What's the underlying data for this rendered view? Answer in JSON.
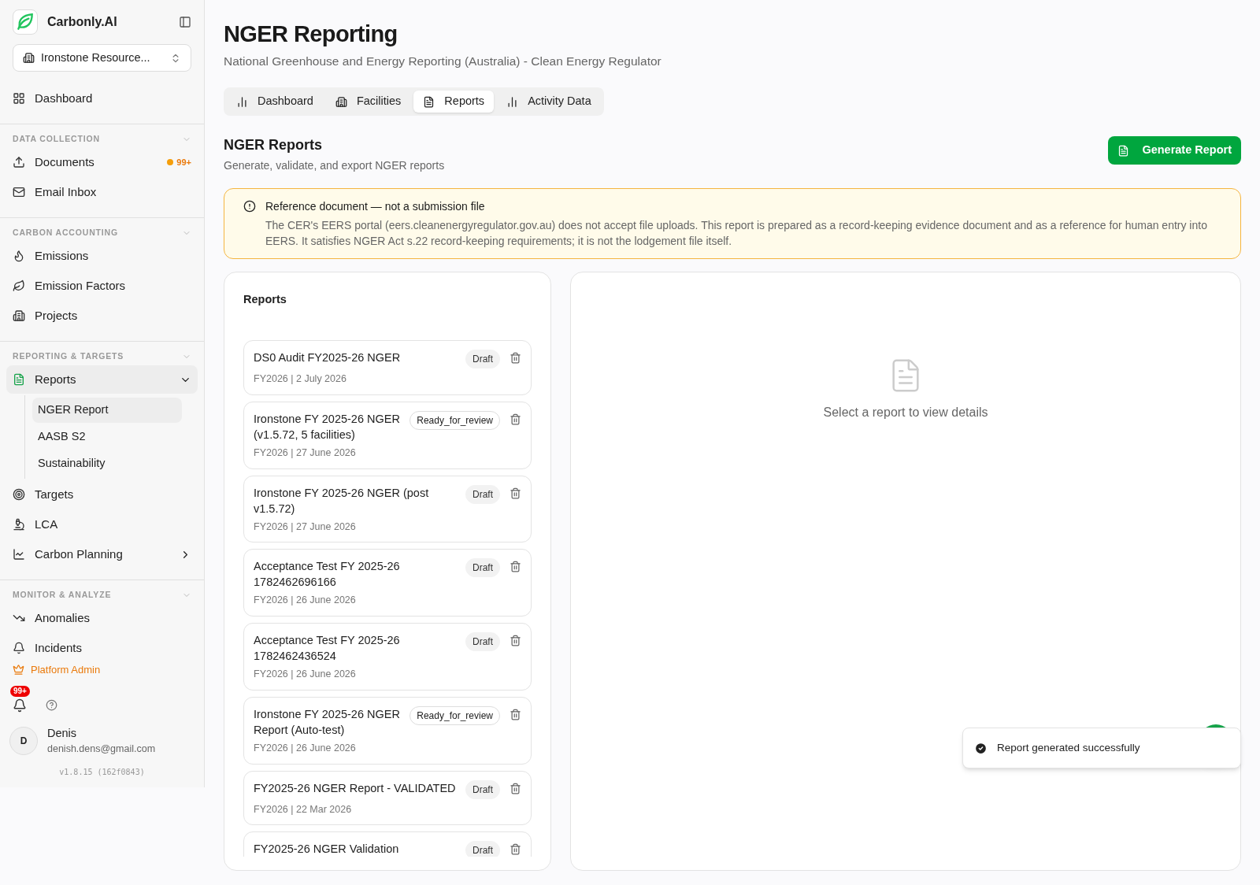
{
  "sidebar": {
    "brand": "Carbonly.AI",
    "org_selector": "Ironstone Resource...",
    "top_items": [
      {
        "label": "Dashboard",
        "selected": false
      }
    ],
    "sections": [
      {
        "title": "DATA COLLECTION",
        "expanded": true,
        "items": [
          {
            "label": "Documents",
            "selected": false,
            "badge": "99+"
          },
          {
            "label": "Email Inbox",
            "selected": false
          }
        ]
      },
      {
        "title": "CARBON ACCOUNTING",
        "expanded": true,
        "items": [
          {
            "label": "Emissions",
            "selected": false
          },
          {
            "label": "Emission Factors",
            "selected": false
          },
          {
            "label": "Projects",
            "selected": false
          }
        ]
      },
      {
        "title": "REPORTING & TARGETS",
        "expanded": true,
        "items": [
          {
            "label": "Reports",
            "selected": true,
            "expanded": true,
            "children": [
              {
                "label": "NGER Report",
                "selected": true
              },
              {
                "label": "AASB S2",
                "selected": false
              },
              {
                "label": "Sustainability",
                "selected": false
              }
            ]
          },
          {
            "label": "Targets",
            "selected": false
          },
          {
            "label": "LCA",
            "selected": false
          },
          {
            "label": "Carbon Planning",
            "selected": false,
            "expanded": false
          }
        ]
      },
      {
        "title": "MONITOR & ANALYZE",
        "expanded": true,
        "items": [
          {
            "label": "Anomalies",
            "selected": false
          },
          {
            "label": "Incidents",
            "selected": false
          }
        ]
      }
    ],
    "admin_link": "Platform Admin",
    "notifications_badge": "99+",
    "user": {
      "initial": "D",
      "name": "Denis",
      "email": "denish.dens@gmail.com"
    },
    "version": "v1.8.15 (162f0843)"
  },
  "page": {
    "title": "NGER Reporting",
    "subtitle": "National Greenhouse and Energy Reporting (Australia) - Clean Energy Regulator",
    "tabs": [
      {
        "label": "Dashboard",
        "selected": false
      },
      {
        "label": "Facilities",
        "selected": false
      },
      {
        "label": "Reports",
        "selected": true
      },
      {
        "label": "Activity Data",
        "selected": false
      }
    ],
    "section_title": "NGER Reports",
    "section_subtitle": "Generate, validate, and export NGER reports",
    "primary_button": "Generate Report",
    "notice": {
      "title": "Reference document — not a submission file",
      "body": "The CER's EERS portal (eers.cleanenergyregulator.gov.au) does not accept file uploads. This report is prepared as a record-keeping evidence document and as a reference for human entry into EERS. It satisfies NGER Act s.22 record-keeping requirements; it is not the lodgement file itself."
    },
    "reports_panel": {
      "title": "Reports",
      "reports": [
        {
          "title": "DS0 Audit FY2025-26 NGER",
          "meta": "FY2026 | 2 July 2026",
          "status": "Draft",
          "kind": "draft"
        },
        {
          "title": "Ironstone FY 2025-26 NGER (v1.5.72, 5 facilities)",
          "meta": "FY2026 | 27 June 2026",
          "status": "Ready_for_review",
          "kind": "review"
        },
        {
          "title": "Ironstone FY 2025-26 NGER (post v1.5.72)",
          "meta": "FY2026 | 27 June 2026",
          "status": "Draft",
          "kind": "draft"
        },
        {
          "title": "Acceptance Test FY 2025-26 1782462696166",
          "meta": "FY2026 | 26 June 2026",
          "status": "Draft",
          "kind": "draft"
        },
        {
          "title": "Acceptance Test FY 2025-26 1782462436524",
          "meta": "FY2026 | 26 June 2026",
          "status": "Draft",
          "kind": "draft"
        },
        {
          "title": "Ironstone FY 2025-26 NGER Report (Auto-test)",
          "meta": "FY2026 | 26 June 2026",
          "status": "Ready_for_review",
          "kind": "review"
        },
        {
          "title": "FY2025-26 NGER Report - VALIDATED",
          "meta": "FY2026 | 22 Mar 2026",
          "status": "Draft",
          "kind": "draft"
        },
        {
          "title": "FY2025-26 NGER Validation",
          "status": "Draft",
          "kind": "draft"
        }
      ]
    },
    "detail_placeholder": "Select a report to view details"
  },
  "toast": {
    "message": "Report generated successfully"
  }
}
